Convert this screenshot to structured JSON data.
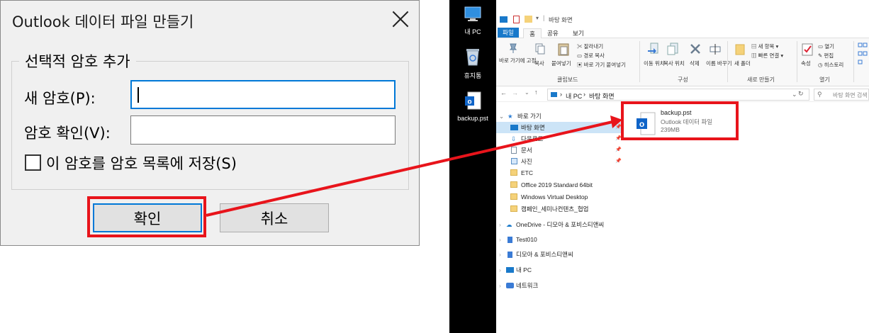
{
  "dialog": {
    "title": "Outlook 데이터 파일 만들기",
    "group_title": "선택적 암호 추가",
    "password_label": "새 암호(P):",
    "confirm_label": "암호 확인(V):",
    "save_checkbox_label": "이 암호를 암호 목록에 저장(S)",
    "ok_label": "확인",
    "cancel_label": "취소"
  },
  "desktop": {
    "icons": [
      {
        "label": "내 PC",
        "icon": "computer-icon"
      },
      {
        "label": "휴지통",
        "icon": "recycle-bin-icon"
      },
      {
        "label": "backup.pst",
        "icon": "outlook-file-icon"
      }
    ]
  },
  "explorer": {
    "title": "바탕 화면",
    "tabs": [
      "파일",
      "홈",
      "공유",
      "보기"
    ],
    "ribbon": {
      "pin_label": "바로 가기에 고정",
      "copy_label": "복사",
      "paste_label": "붙여넣기",
      "cut_label": "잘라내기",
      "copy_path_label": "경로 복사",
      "paste_shortcut_label": "바로 가기 붙여넣기",
      "clipboard_group": "클립보드",
      "move_label": "이동 위치",
      "copyto_label": "복사 위치",
      "delete_label": "삭제",
      "rename_label": "이름 바꾸기",
      "organize_group": "구성",
      "new_folder_label": "새 폴더",
      "new_item_label": "새 항목",
      "easy_access_label": "빠른 연결",
      "new_group": "새로 만들기",
      "properties_label": "속성",
      "open_label": "열기",
      "edit_label": "편집",
      "history_label": "히스토리",
      "open_group": "열기"
    },
    "address": [
      "내 PC",
      "바탕 화면"
    ],
    "search_placeholder": "바탕 화면 검색",
    "nav": {
      "quick_access": "바로 가기",
      "items": [
        "바탕 화면",
        "다운로드",
        "문서",
        "사진",
        "ETC",
        "Office 2019 Standard 64bit",
        "Windows Virtual Desktop",
        "캠페인_세미나컨텐츠_협업"
      ],
      "roots": [
        "OneDrive - 디모아 & 포비스티앤씨",
        "Test010",
        "디모아 & 포비스티앤씨",
        "내 PC",
        "네트워크"
      ]
    },
    "file": {
      "name": "backup.pst",
      "type": "Outlook 데이터 파일",
      "size": "239MB"
    }
  },
  "colors": {
    "highlight_red": "#e8141b",
    "focus_blue": "#0078d7",
    "outlook_blue": "#0f64c8"
  }
}
